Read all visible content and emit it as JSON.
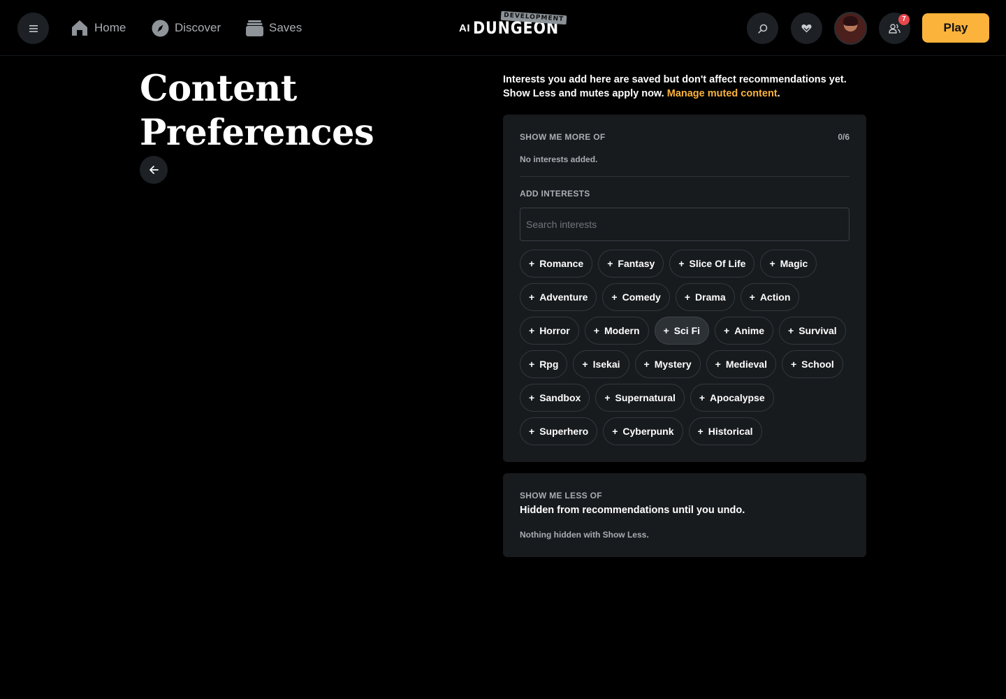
{
  "nav": {
    "home": "Home",
    "discover": "Discover",
    "saves": "Saves"
  },
  "logo": {
    "ai": "AI",
    "name": "DUNGEON",
    "tag": "DEVELOPMENT"
  },
  "header": {
    "notification_count": "7",
    "play_label": "Play"
  },
  "page": {
    "title": "Content Preferences"
  },
  "intro": {
    "text": "Interests you add here are saved but don't affect recommendations yet. Show Less and mutes apply now.",
    "link": "Manage muted content",
    "end": "."
  },
  "more": {
    "label": "SHOW ME MORE OF",
    "count": "0/6",
    "empty": "No interests added.",
    "add_label": "ADD INTERESTS",
    "search_placeholder": "Search interests",
    "rows": [
      [
        "Romance",
        "Fantasy",
        "Slice Of Life",
        "Magic"
      ],
      [
        "Adventure",
        "Comedy",
        "Drama",
        "Action"
      ],
      [
        "Horror",
        "Modern",
        "Sci Fi",
        "Anime",
        "Survival"
      ],
      [
        "Rpg",
        "Isekai",
        "Mystery",
        "Medieval",
        "School"
      ],
      [
        "Sandbox",
        "Supernatural",
        "Apocalypse"
      ],
      [
        "Superhero",
        "Cyberpunk",
        "Historical"
      ]
    ]
  },
  "less": {
    "label": "SHOW ME LESS OF",
    "heading": "Hidden from recommendations until you undo.",
    "empty": "Nothing hidden with Show Less."
  },
  "colors": {
    "accent": "#fbb33b",
    "badge": "#e5484d",
    "card": "#181b1e"
  }
}
